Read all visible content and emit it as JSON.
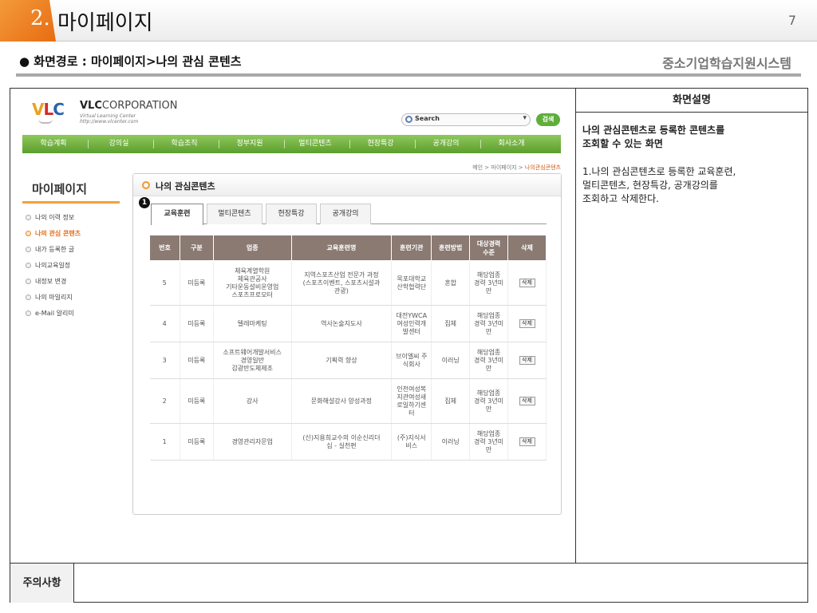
{
  "slide": {
    "number_prefix": "2.",
    "title": "마이페이지",
    "page_number": "7",
    "path_text": "● 화면경로 : 마이페이지>나의 관심 콘텐츠",
    "system_name": "중소기업학습지원시스템"
  },
  "site": {
    "logo": {
      "v": "V",
      "l": "L",
      "c": "C"
    },
    "corp_name_bold": "VLC",
    "corp_name_rest": "CORPORATION",
    "corp_sub": "Virtual Learning Center\nhttp://www.vlcenter.com",
    "search": {
      "placeholder": "Search",
      "dropdown_icon": "▾",
      "button": "검색"
    },
    "nav": [
      "학습계획",
      "강의실",
      "학습조직",
      "정부지원",
      "멀티콘텐츠",
      "현장특강",
      "공개강의",
      "회사소개"
    ],
    "breadcrumb": {
      "path": "메인 > 마이페이지 > ",
      "current": "나의관심콘텐츠"
    },
    "sidebar": {
      "title": "마이페이지",
      "items": [
        {
          "label": "나의 이력 정보",
          "active": false
        },
        {
          "label": "나의 관심 콘텐츠",
          "active": true
        },
        {
          "label": "내가 등록한 글",
          "active": false
        },
        {
          "label": "나의교육일정",
          "active": false
        },
        {
          "label": "내정보 변경",
          "active": false
        },
        {
          "label": "나의 마일리지",
          "active": false
        },
        {
          "label": "e-Mail 알리미",
          "active": false
        }
      ]
    },
    "content": {
      "title": "나의 관심콘텐츠",
      "badge": "1",
      "tabs": [
        "교육훈련",
        "멀티콘텐츠",
        "현장특강",
        "공개강의"
      ],
      "active_tab": 0,
      "columns": [
        "번호",
        "구분",
        "업종",
        "교육훈련명",
        "훈련기관",
        "훈련방법",
        "대상경력\n수준",
        "삭제"
      ],
      "rows": [
        {
          "no": "5",
          "type": "미등록",
          "industry": "체육계열학원\n체육관공사\n기타운동설비운영업\n스포츠프로모터",
          "course": "지역스포츠산업 전문가 과정\n(스포츠이벤트, 스포츠시설과\n관광)",
          "institution": "목포대학교\n산학협력단",
          "method": "혼합",
          "level": "해당업종\n경력 3년미\n만",
          "delete": "삭제"
        },
        {
          "no": "4",
          "type": "미등록",
          "industry": "텔레마케팅",
          "course": "역사논술지도사",
          "institution": "대전YWCA\n여성인력개\n발센터",
          "method": "집체",
          "level": "해당업종\n경력 3년미\n만",
          "delete": "삭제"
        },
        {
          "no": "3",
          "type": "미등록",
          "industry": "소프트웨어개발서비스\n경영일반\n감광반도체제조",
          "course": "기획력 향상",
          "institution": "브이엘씨 주\n식회사",
          "method": "이러닝",
          "level": "해당업종\n경력 3년미\n만",
          "delete": "삭제"
        },
        {
          "no": "2",
          "type": "미등록",
          "industry": "강사",
          "course": "문화해설강사 양성과정",
          "institution": "인천여성복\n지관여성새\n로일하기센\n터",
          "method": "집체",
          "level": "해당업종\n경력 3년미\n만",
          "delete": "삭제"
        },
        {
          "no": "1",
          "type": "미등록",
          "industry": "경영관리자문업",
          "course": "(신)지용희교수의 이순신리더\n십 - 실천편",
          "institution": "(주)지식서\n비스",
          "method": "이러닝",
          "level": "해당업종\n경력 3년미\n만",
          "delete": "삭제"
        }
      ]
    }
  },
  "description": {
    "header": "화면설명",
    "summary": "나의 관심콘텐츠로 등록한  콘텐츠를\n 조회할 수 있는 화면",
    "detail": "1.나의 관심콘텐츠로 등록한  교육훈련,\n 멀티콘텐츠, 현장특강, 공개강의를\n 조회하고 삭제한다."
  },
  "notes": {
    "label": "주의사항"
  },
  "colors": {
    "accent_orange": "#e86c12",
    "nav_green": "#6aad37",
    "table_header": "#8a7a72",
    "search_button_green": "#5fae3a"
  }
}
